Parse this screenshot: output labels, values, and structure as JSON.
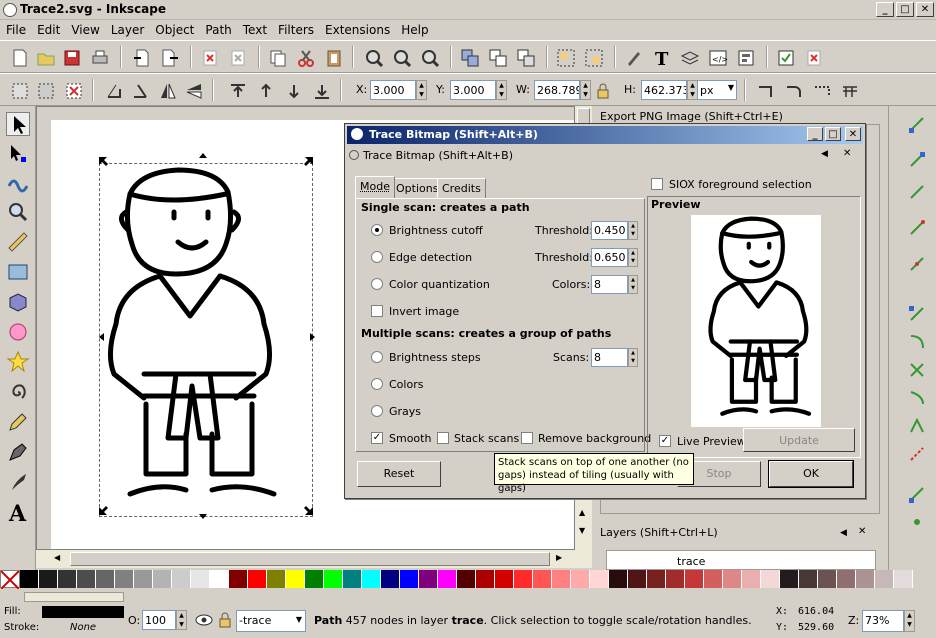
{
  "window": {
    "title": "Trace2.svg - Inkscape"
  },
  "menu": [
    "File",
    "Edit",
    "View",
    "Layer",
    "Object",
    "Path",
    "Text",
    "Filters",
    "Extensions",
    "Help"
  ],
  "toolbar": {
    "x_label": "X:",
    "x_value": "3.000",
    "y_label": "Y:",
    "y_value": "3.000",
    "w_label": "W:",
    "w_value": "268.789",
    "h_label": "H:",
    "h_value": "462.373",
    "unit": "px"
  },
  "dock": {
    "export_title": "Export PNG Image (Shift+Ctrl+E)",
    "layers_title": "Layers (Shift+Ctrl+L)",
    "layer_row": "trace"
  },
  "dialog": {
    "title": "Trace Bitmap (Shift+Alt+B)",
    "subtitle": "Trace Bitmap (Shift+Alt+B)",
    "tabs": [
      "Mode",
      "Options",
      "Credits"
    ],
    "single_header": "Single scan: creates a path",
    "brightness_label": "Brightness cutoff",
    "threshold_label": "Threshold:",
    "brightness_threshold": "0.450",
    "edge_label": "Edge detection",
    "edge_threshold": "0.650",
    "color_quant_label": "Color quantization",
    "colors_label": "Colors:",
    "colors_value": "8",
    "invert_label": "Invert image",
    "multi_header": "Multiple scans: creates a group of paths",
    "brightness_steps_label": "Brightness steps",
    "scans_label": "Scans:",
    "scans_value": "8",
    "colors_option": "Colors",
    "grays_option": "Grays",
    "smooth_label": "Smooth",
    "stack_label": "Stack scans",
    "remove_bg_label": "Remove background",
    "siox_label": "SIOX foreground selection",
    "preview_label": "Preview",
    "live_preview_label": "Live Preview",
    "update_label": "Update",
    "reset_label": "Reset",
    "stop_label": "Stop",
    "ok_label": "OK",
    "tooltip": "Stack scans on top of one another (no gaps) instead of tiling (usually with gaps)"
  },
  "status": {
    "fill_label": "Fill:",
    "stroke_label": "Stroke:",
    "stroke_value": "None",
    "opacity_label": "O:",
    "opacity_value": "100",
    "layer_select": "-trace",
    "message_type": "Path",
    "message_rest": " 457 nodes in layer ",
    "message_layer": "trace",
    "message_end": ". Click selection to toggle scale/rotation handles.",
    "x_label": "X:",
    "x_value": "616.04",
    "y_label": "Y:",
    "y_value": "529.60",
    "z_label": "Z:",
    "zoom": "73%"
  },
  "palette": [
    "#000000",
    "#1a1a1a",
    "#333333",
    "#4d4d4d",
    "#666666",
    "#808080",
    "#999999",
    "#b3b3b3",
    "#cccccc",
    "#e6e6e6",
    "#ffffff",
    "#800000",
    "#ff0000",
    "#808000",
    "#ffff00",
    "#008000",
    "#00ff00",
    "#008080",
    "#00ffff",
    "#000080",
    "#0000ff",
    "#800080",
    "#ff00ff",
    "#550000",
    "#aa0000",
    "#d40000",
    "#ff2a2a",
    "#ff5555",
    "#ff8080",
    "#ffaaaa",
    "#ffd5d5",
    "#280b0b",
    "#501616",
    "#782121",
    "#a02c2c",
    "#c83737",
    "#d35f5f",
    "#de8787",
    "#e9afaf",
    "#f4d7d7",
    "#241c1c",
    "#483737",
    "#6c5353",
    "#916f6f",
    "#ac9393",
    "#c8b7b7",
    "#e3dbdb"
  ]
}
